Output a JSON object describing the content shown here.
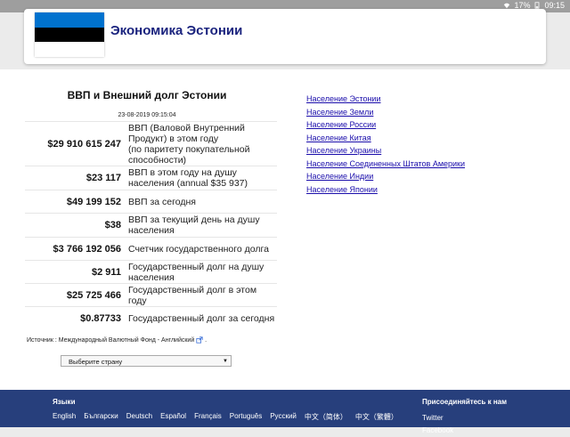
{
  "status_bar": {
    "battery": "17%",
    "time": "09:15"
  },
  "header": {
    "title": "Экономика Эстонии",
    "flag_colors": [
      "#0072ce",
      "#000000",
      "#ffffff"
    ]
  },
  "stats_panel": {
    "title": "ВВП и Внешний долг Эстонии",
    "timestamp": "23-08-2019 09:15:04",
    "rows": [
      {
        "value": "$29 910 615 247",
        "label": "ВВП (Валовой Внутренний Продукт) в этом году\n(по паритету покупательной способности)"
      },
      {
        "value": "$23 117",
        "label": "ВВП в этом году на душу населения (annual $35 937)"
      },
      {
        "value": "$49 199 152",
        "label": "ВВП за сегодня"
      },
      {
        "value": "$38",
        "label": "ВВП за текущий день на душу населения"
      },
      {
        "value": "$3 766 192 056",
        "label": "Счетчик государственного долга"
      },
      {
        "value": "$2 911",
        "label": "Государственный долг на душу населения"
      },
      {
        "value": "$25 725 466",
        "label": "Государственный долг в этом году"
      },
      {
        "value": "$0.87733",
        "label": "Государственный долг за сегодня"
      }
    ],
    "source": "Источник : Международный Валютный Фонд - Английский",
    "source_suffix": ".",
    "country_select": "Выберите страну"
  },
  "links": [
    "Население Эстонии",
    "Население Земли",
    "Население России",
    "Население Китая",
    "Население Украины",
    "Население Соединенных Штатов Америки",
    "Население Индии",
    "Население Японии"
  ],
  "footer": {
    "languages_title": "Языки",
    "languages": [
      "English",
      "Български",
      "Deutsch",
      "Español",
      "Français",
      "Português",
      "Русский",
      "中文（简体）",
      "中文（繁體）"
    ],
    "join_title": "Присоединяйтесь к нам",
    "social": [
      "Twitter",
      "Facebook"
    ]
  },
  "colors": {
    "link": "#1a0dab",
    "footer_bg": "#273f7c",
    "title": "#1a237e"
  }
}
